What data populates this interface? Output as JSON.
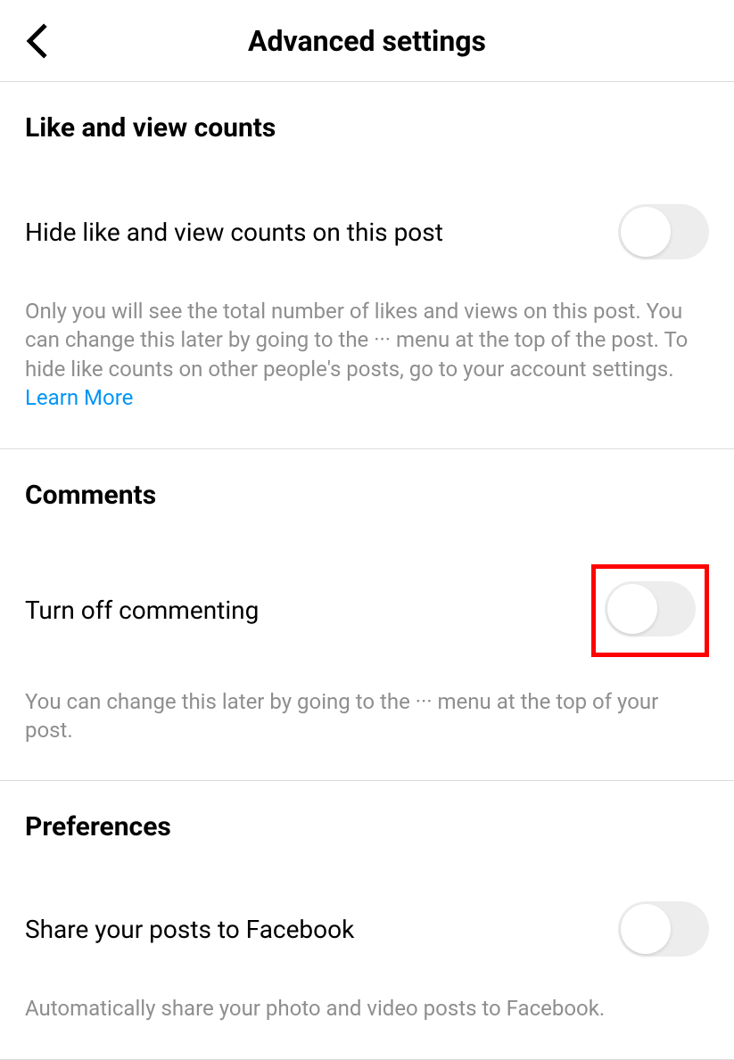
{
  "header": {
    "title": "Advanced settings"
  },
  "sections": {
    "likes": {
      "title": "Like and view counts",
      "setting_label": "Hide like and view counts on this post",
      "description": "Only you will see the total number of likes and views on this post. You can change this later by going to the ··· menu at the top of the post. To hide like counts on other people's posts, go to your account settings. ",
      "learn_more": "Learn More"
    },
    "comments": {
      "title": "Comments",
      "setting_label": "Turn off commenting",
      "description": "You can change this later by going to the ··· menu at the top of your post."
    },
    "preferences": {
      "title": "Preferences",
      "setting_label": "Share your posts to Facebook",
      "description": "Automatically share your photo and video posts to Facebook."
    }
  }
}
